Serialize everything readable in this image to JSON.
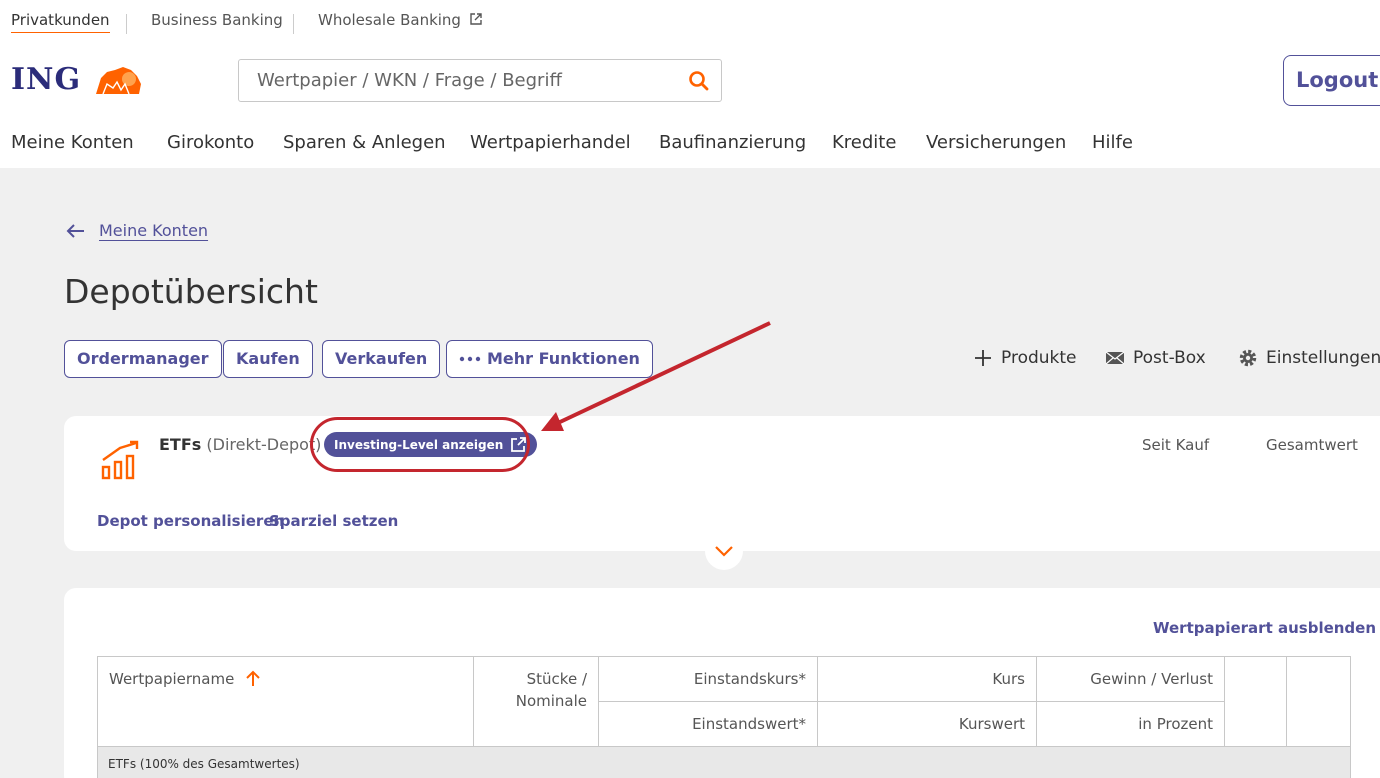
{
  "segments": {
    "privat": "Privatkunden",
    "business": "Business Banking",
    "wholesale": "Wholesale Banking"
  },
  "brand": {
    "logo_text": "ING",
    "accent": "#ff6200",
    "primary": "#525199"
  },
  "search": {
    "placeholder": "Wertpapier / WKN / Frage / Begriff"
  },
  "header": {
    "logout": "Logout"
  },
  "nav": [
    "Meine Konten",
    "Girokonto",
    "Sparen & Anlegen",
    "Wertpapierhandel",
    "Baufinanzierung",
    "Kredite",
    "Versicherungen",
    "Hilfe"
  ],
  "breadcrumb": {
    "back_label": "Meine Konten"
  },
  "page": {
    "title": "Depotübersicht"
  },
  "actions": {
    "ordermanager": "Ordermanager",
    "kaufen": "Kaufen",
    "verkaufen": "Verkaufen",
    "mehr": "Mehr Funktionen"
  },
  "right_actions": {
    "produkte": "Produkte",
    "postbox": "Post-Box",
    "einstellungen": "Einstellungen"
  },
  "depot": {
    "name": "ETFs",
    "type": "(Direkt-Depot)",
    "investing_level": "Investing-Level anzeigen",
    "col_seit_kauf": "Seit Kauf",
    "col_gesamtwert": "Gesamtwert",
    "personalisieren": "Depot personalisieren",
    "sparziel": "Sparziel setzen"
  },
  "holdings": {
    "hide_type": "Wertpapierart ausblenden",
    "headers": {
      "name": "Wertpapiername",
      "stuecke": "Stücke /",
      "nominale": "Nominale",
      "einstandskurs": "Einstandskurs*",
      "einstandswert": "Einstandswert*",
      "kurs": "Kurs",
      "kurswert": "Kurswert",
      "gewinn": "Gewinn / Verlust",
      "prozent": "in Prozent"
    },
    "group_label": "ETFs (100% des Gesamtwertes)"
  }
}
